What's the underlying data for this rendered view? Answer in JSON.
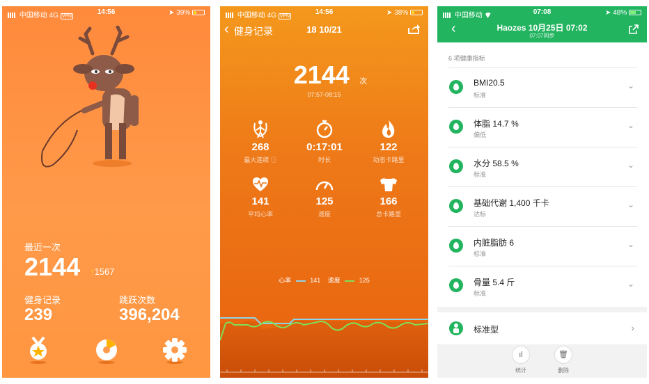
{
  "phone1": {
    "status": {
      "carrier": "中国移动",
      "network": "4G",
      "vpn": "VPN",
      "time": "14:56",
      "battery": "39%"
    },
    "recent_label": "最近一次",
    "recent_value": "2144",
    "recent_delta": "1567",
    "records_label": "健身记录",
    "records_value": "239",
    "jumps_label": "跳跃次数",
    "jumps_value": "396,204",
    "bottom_icons": [
      "medal-icon",
      "chart-icon",
      "gear-icon"
    ]
  },
  "phone2": {
    "status": {
      "carrier": "中国移动",
      "network": "4G",
      "vpn": "VPN",
      "time": "14:56",
      "battery": "38%"
    },
    "back_label": "健身记录",
    "date": "18 10/21",
    "count": "2144",
    "count_unit": "次",
    "time_range": "07:57-08:15",
    "stats": [
      {
        "icon": "jump-rope-icon",
        "value": "268",
        "label": "最大连续 ⓘ"
      },
      {
        "icon": "stopwatch-icon",
        "value": "0:17:01",
        "label": "时长"
      },
      {
        "icon": "flame-icon",
        "value": "122",
        "label": "动态卡路里"
      },
      {
        "icon": "heart-rate-icon",
        "value": "141",
        "label": "平均心率"
      },
      {
        "icon": "speedometer-icon",
        "value": "125",
        "label": "速度"
      },
      {
        "icon": "muscle-icon",
        "value": "166",
        "label": "总卡路里"
      }
    ],
    "legend": {
      "hr_label": "心率",
      "hr_value": "141",
      "speed_label": "速度",
      "speed_value": "125"
    },
    "colors": {
      "hr_line": "#8fd3e8",
      "speed_line": "#7ee05a"
    }
  },
  "phone3": {
    "status": {
      "carrier": "中国移动",
      "time": "07:08",
      "battery": "48%"
    },
    "title": "Haozes 10月25日 07:02",
    "subtitle": "07:07同步",
    "section_label": "6 项健康指标",
    "items": [
      {
        "name": "BMI",
        "value": "20.5",
        "unit": "",
        "status": "标准"
      },
      {
        "name": "体脂",
        "value": "14.7",
        "unit": "%",
        "status": "偏低"
      },
      {
        "name": "水分",
        "value": "58.5",
        "unit": "%",
        "status": "标准"
      },
      {
        "name": "基础代谢",
        "value": "1,400",
        "unit": "千卡",
        "status": "达标"
      },
      {
        "name": "内脏脂肪",
        "value": "6",
        "unit": "",
        "status": "标准"
      },
      {
        "name": "骨量",
        "value": "5.4",
        "unit": "斤",
        "status": "标准"
      }
    ],
    "body_type": "标准型",
    "actions": [
      {
        "icon": "bar-chart-icon",
        "label": "统计"
      },
      {
        "icon": "trash-icon",
        "label": "删除"
      }
    ],
    "accent": "#22b45f"
  }
}
